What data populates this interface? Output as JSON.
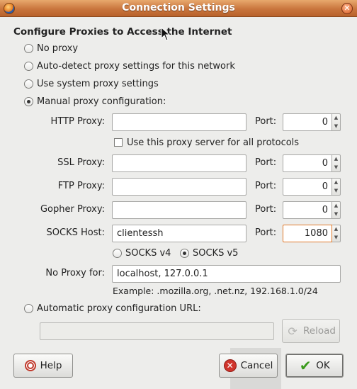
{
  "window": {
    "title": "Connection Settings",
    "close_glyph": "✕"
  },
  "heading": "Configure Proxies to Access the Internet",
  "options": {
    "no_proxy": "No proxy",
    "auto_detect": "Auto-detect proxy settings for this network",
    "system": "Use system proxy settings",
    "manual": "Manual proxy configuration:",
    "auto_url": "Automatic proxy configuration URL:",
    "selected": "manual"
  },
  "manual": {
    "http_label": "HTTP Proxy:",
    "http_value": "",
    "http_port": "0",
    "use_all_label": "Use this proxy server for all protocols",
    "use_all_checked": false,
    "ssl_label": "SSL Proxy:",
    "ssl_value": "",
    "ssl_port": "0",
    "ftp_label": "FTP Proxy:",
    "ftp_value": "",
    "ftp_port": "0",
    "gopher_label": "Gopher Proxy:",
    "gopher_value": "",
    "gopher_port": "0",
    "socks_label": "SOCKS Host:",
    "socks_value": "clientessh",
    "socks_port": "1080",
    "port_label": "Port:",
    "socks_v4": "SOCKS v4",
    "socks_v5": "SOCKS v5",
    "socks_version_selected": "v5",
    "no_proxy_label": "No Proxy for:",
    "no_proxy_value": "localhost, 127.0.0.1",
    "example": "Example: .mozilla.org, .net.nz, 192.168.1.0/24"
  },
  "auto_url_value": "",
  "buttons": {
    "reload": "Reload",
    "help": "Help",
    "cancel": "Cancel",
    "ok": "OK"
  },
  "icons": {
    "app": "firefox-icon",
    "close": "close-icon",
    "help": "help-icon",
    "cancel": "cancel-icon",
    "ok": "ok-checkmark-icon",
    "reload": "reload-icon"
  },
  "colors": {
    "titlebar": "#c9753d",
    "focus_border": "#e07a2b",
    "background": "#ededeb"
  }
}
